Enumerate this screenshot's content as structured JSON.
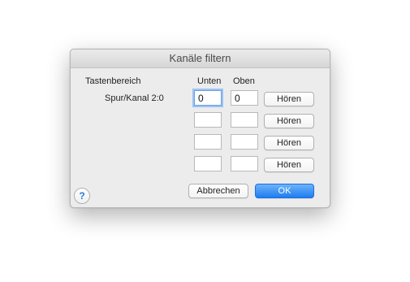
{
  "dialog": {
    "title": "Kanäle filtern",
    "range_label": "Tastenbereich",
    "columns": {
      "low": "Unten",
      "high": "Oben"
    },
    "rows": [
      {
        "label": "Spur/Kanal 2:0",
        "low": "0",
        "high": "0",
        "listen": "Hören"
      },
      {
        "label": "",
        "low": "",
        "high": "",
        "listen": "Hören"
      },
      {
        "label": "",
        "low": "",
        "high": "",
        "listen": "Hören"
      },
      {
        "label": "",
        "low": "",
        "high": "",
        "listen": "Hören"
      }
    ],
    "buttons": {
      "cancel": "Abbrechen",
      "ok": "OK"
    },
    "help_glyph": "?",
    "icons": {
      "help": "help-icon"
    },
    "colors": {
      "accent": "#1f7cf0",
      "focus_ring": "#9cc2f2"
    }
  }
}
